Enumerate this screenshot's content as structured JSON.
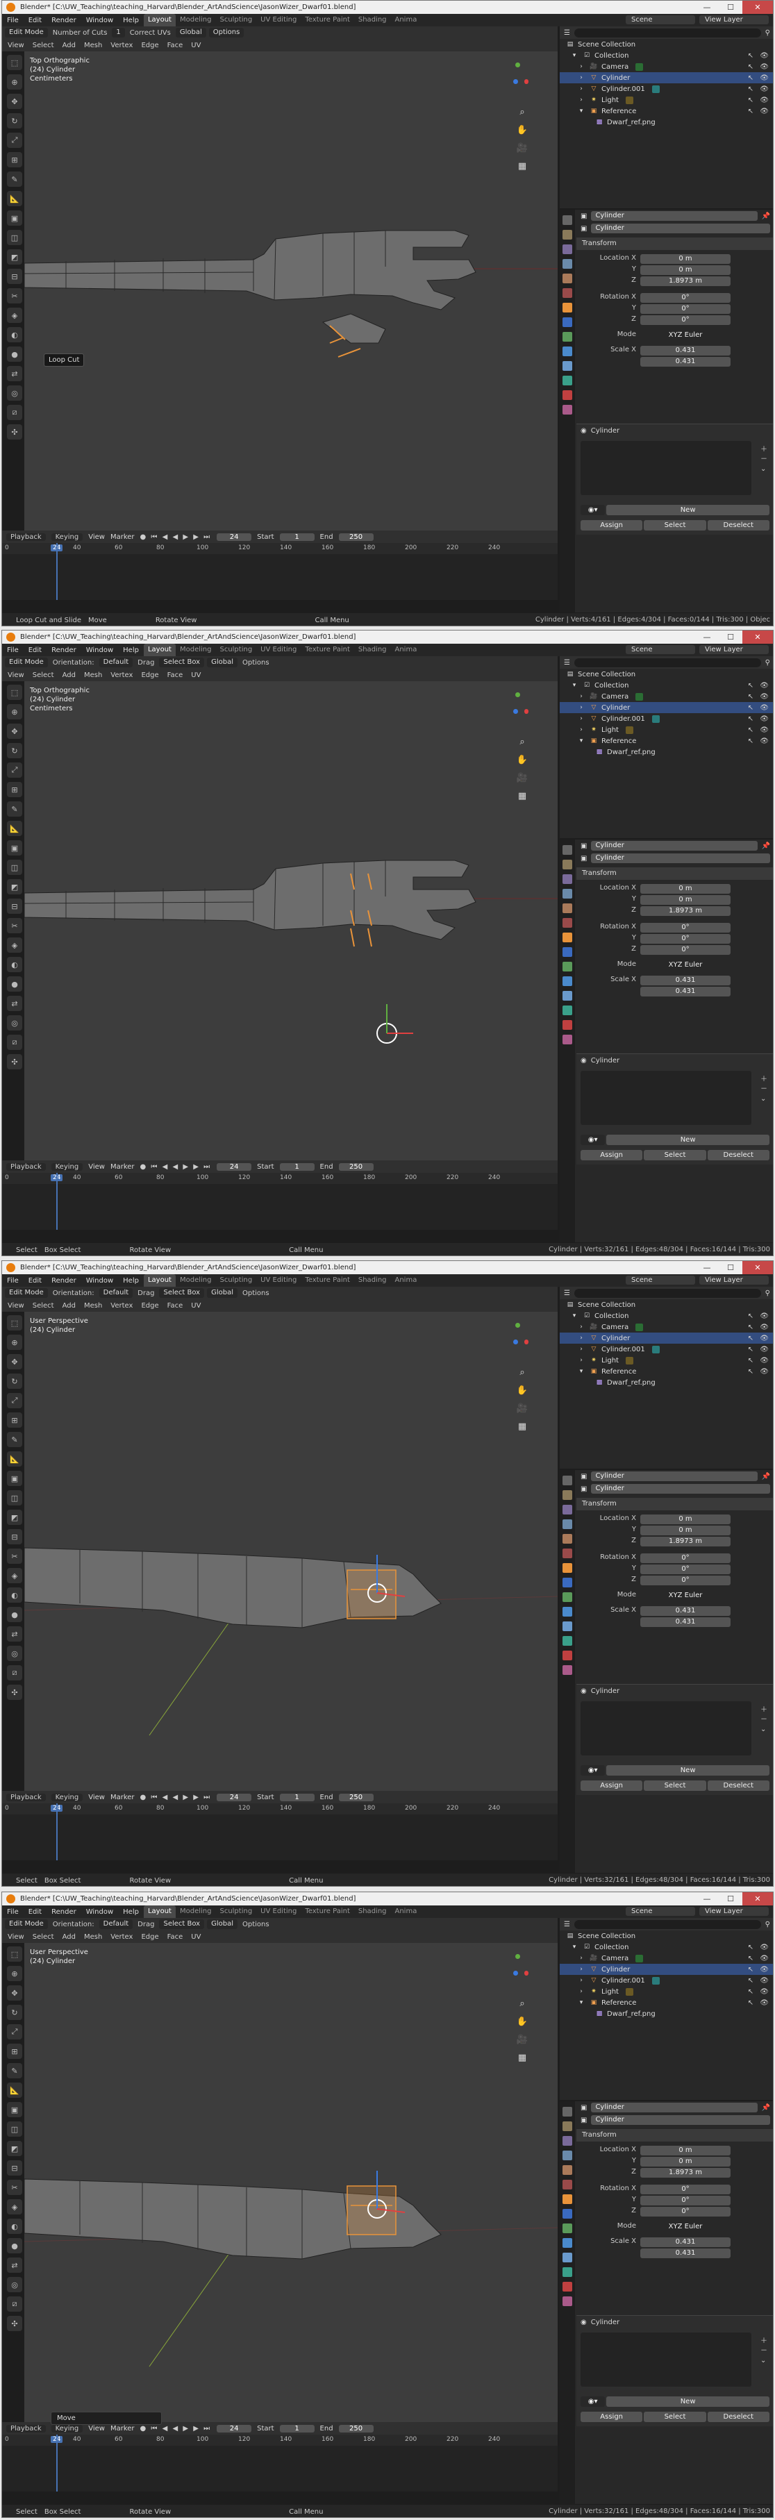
{
  "panels": [
    {
      "title": "Blender* [C:\\UW_Teaching\\teaching_Harvard\\Blender_ArtAndScience\\JasonWizer_Dwarf01.blend]",
      "menu": [
        "File",
        "Edit",
        "Render",
        "Window",
        "Help"
      ],
      "workspaces": [
        "Layout",
        "Modeling",
        "Sculpting",
        "UV Editing",
        "Texture Paint",
        "Shading",
        "Anima"
      ],
      "active_workspace": "Layout",
      "scene": "Scene",
      "view_layer": "View Layer",
      "header": {
        "mode": "Edit Mode",
        "items": [
          "Number of Cuts",
          "1",
          "Correct UVs",
          "Global",
          "Options"
        ],
        "menu": [
          "View",
          "Select",
          "Add",
          "Mesh",
          "Vertex",
          "Edge",
          "Face",
          "UV"
        ]
      },
      "viewport": {
        "view_name": "Top Orthographic",
        "object": "(24) Cylinder",
        "units": "Centimeters",
        "tooltip": "Loop Cut",
        "op_panel": ""
      },
      "outliner": [
        "Scene Collection",
        "Collection",
        "Camera",
        "Cylinder",
        "Cylinder.001",
        "Light",
        "Reference",
        "Dwarf_ref.png"
      ],
      "status": {
        "left": [
          "Loop Cut and Slide",
          "Move",
          "Rotate View",
          "Call Menu"
        ],
        "right": "Cylinder | Verts:4/161 | Edges:4/304 | Faces:0/144 | Tris:300 | Objec"
      }
    },
    {
      "title": "Blender* [C:\\UW_Teaching\\teaching_Harvard\\Blender_ArtAndScience\\JasonWizer_Dwarf01.blend]",
      "menu": [
        "File",
        "Edit",
        "Render",
        "Window",
        "Help"
      ],
      "workspaces": [
        "Layout",
        "Modeling",
        "Sculpting",
        "UV Editing",
        "Texture Paint",
        "Shading",
        "Anima"
      ],
      "active_workspace": "Layout",
      "scene": "Scene",
      "view_layer": "View Layer",
      "header": {
        "mode": "Edit Mode",
        "items": [
          "Orientation:",
          "Default",
          "Drag",
          "Select Box",
          "Global",
          "Options"
        ],
        "menu": [
          "View",
          "Select",
          "Add",
          "Mesh",
          "Vertex",
          "Edge",
          "Face",
          "UV"
        ]
      },
      "viewport": {
        "view_name": "Top Orthographic",
        "object": "(24) Cylinder",
        "units": "Centimeters",
        "tooltip": "",
        "op_panel": ""
      },
      "outliner": [
        "Scene Collection",
        "Collection",
        "Camera",
        "Cylinder",
        "Cylinder.001",
        "Light",
        "Reference",
        "Dwarf_ref.png"
      ],
      "status": {
        "left": [
          "Select",
          "Box Select",
          "Rotate View",
          "Call Menu"
        ],
        "right": "Cylinder | Verts:32/161 | Edges:48/304 | Faces:16/144 | Tris:300"
      }
    },
    {
      "title": "Blender* [C:\\UW_Teaching\\teaching_Harvard\\Blender_ArtAndScience\\JasonWizer_Dwarf01.blend]",
      "menu": [
        "File",
        "Edit",
        "Render",
        "Window",
        "Help"
      ],
      "workspaces": [
        "Layout",
        "Modeling",
        "Sculpting",
        "UV Editing",
        "Texture Paint",
        "Shading",
        "Anima"
      ],
      "active_workspace": "Layout",
      "scene": "Scene",
      "view_layer": "View Layer",
      "header": {
        "mode": "Edit Mode",
        "items": [
          "Orientation:",
          "Default",
          "Drag",
          "Select Box",
          "Global",
          "Options"
        ],
        "menu": [
          "View",
          "Select",
          "Add",
          "Mesh",
          "Vertex",
          "Edge",
          "Face",
          "UV"
        ]
      },
      "viewport": {
        "view_name": "User Perspective",
        "object": "(24) Cylinder",
        "units": "",
        "tooltip": "",
        "op_panel": ""
      },
      "outliner": [
        "Scene Collection",
        "Collection",
        "Camera",
        "Cylinder",
        "Cylinder.001",
        "Light",
        "Reference",
        "Dwarf_ref.png"
      ],
      "status": {
        "left": [
          "Select",
          "Box Select",
          "Rotate View",
          "Call Menu"
        ],
        "right": "Cylinder | Verts:32/161 | Edges:48/304 | Faces:16/144 | Tris:300"
      }
    },
    {
      "title": "Blender* [C:\\UW_Teaching\\teaching_Harvard\\Blender_ArtAndScience\\JasonWizer_Dwarf01.blend]",
      "menu": [
        "File",
        "Edit",
        "Render",
        "Window",
        "Help"
      ],
      "workspaces": [
        "Layout",
        "Modeling",
        "Sculpting",
        "UV Editing",
        "Texture Paint",
        "Shading",
        "Anima"
      ],
      "active_workspace": "Layout",
      "scene": "Scene",
      "view_layer": "View Layer",
      "header": {
        "mode": "Edit Mode",
        "items": [
          "Orientation:",
          "Default",
          "Drag",
          "Select Box",
          "Global",
          "Options"
        ],
        "menu": [
          "View",
          "Select",
          "Add",
          "Mesh",
          "Vertex",
          "Edge",
          "Face",
          "UV"
        ]
      },
      "viewport": {
        "view_name": "User Perspective",
        "object": "(24) Cylinder",
        "units": "",
        "tooltip": "",
        "op_panel": "Move"
      },
      "outliner": [
        "Scene Collection",
        "Collection",
        "Camera",
        "Cylinder",
        "Cylinder.001",
        "Light",
        "Reference",
        "Dwarf_ref.png"
      ],
      "status": {
        "left": [
          "Select",
          "Box Select",
          "Rotate View",
          "Call Menu"
        ],
        "right": "Cylinder | Verts:32/161 | Edges:48/304 | Faces:16/144 | Tris:300"
      }
    }
  ],
  "timeline": {
    "menu": [
      "Playback",
      "Keying",
      "View",
      "Marker"
    ],
    "current_frame": "24",
    "start_label": "Start",
    "start": "1",
    "end_label": "End",
    "end": "250",
    "ruler": [
      "0",
      "40",
      "60",
      "80",
      "100",
      "120",
      "140",
      "160",
      "180",
      "200",
      "220",
      "240"
    ]
  },
  "properties": {
    "object_name": "Cylinder",
    "section": "Transform",
    "location_label": "Location X",
    "loc": [
      "0 m",
      "0 m",
      "1.8973 m"
    ],
    "rotation_label": "Rotation X",
    "rot": [
      "0°",
      "0°",
      "0°"
    ],
    "mode_label": "Mode",
    "mode": "XYZ Euler",
    "scale_label": "Scale X",
    "scale": [
      "0.431",
      "0.431"
    ],
    "axis_y": "Y",
    "axis_z": "Z",
    "material_name": "Cylinder",
    "new_btn": "New",
    "buttons": [
      "Assign",
      "Select",
      "Deselect"
    ]
  },
  "colors": {
    "accent": "#4772b3",
    "selection": "#e8933a",
    "mesh": "#7a7a7a",
    "viewport_bg": "#3d3d3d"
  }
}
